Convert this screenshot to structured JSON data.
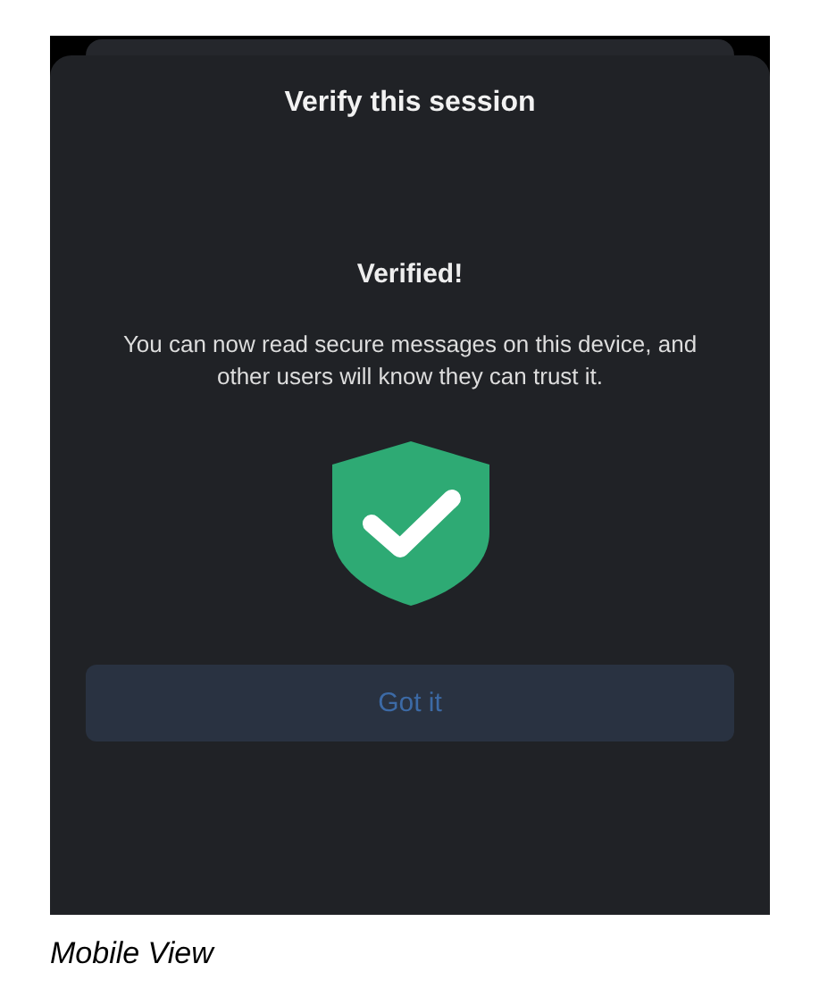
{
  "sheet": {
    "title": "Verify this session",
    "heading": "Verified!",
    "message": "You can now read secure messages on this device, and other users will know they can trust it.",
    "button": {
      "label": "Got it"
    }
  },
  "caption": "Mobile View"
}
